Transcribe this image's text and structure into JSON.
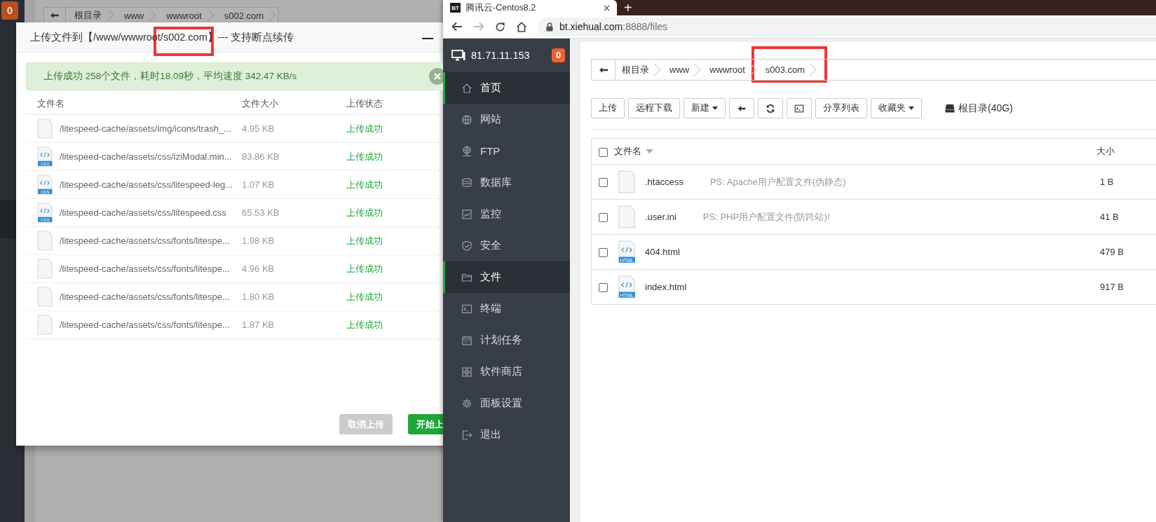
{
  "left_window": {
    "notice_badge": "0",
    "breadcrumb": [
      "根目录",
      "www",
      "wwwroot",
      "s002.com"
    ]
  },
  "upload_dialog": {
    "title": "上传文件到【/www/wwwroot/s002.com】--- 支持断点续传",
    "alert": "上传成功 258个文件，耗时18.09秒，平均速度 342.47 KB/s",
    "columns": [
      "文件名",
      "文件大小",
      "上传状态"
    ],
    "rows": [
      {
        "kind": "file",
        "name": "/litespeed-cache/assets/img/icons/trash_...",
        "size": "4.95 KB",
        "status": "上传成功"
      },
      {
        "kind": "css",
        "icon_label": "CSS",
        "name": "/litespeed-cache/assets/css/iziModal.min...",
        "size": "83.86 KB",
        "status": "上传成功"
      },
      {
        "kind": "css",
        "icon_label": "CSS",
        "name": "/litespeed-cache/assets/css/litespeed-leg...",
        "size": "1.07 KB",
        "status": "上传成功"
      },
      {
        "kind": "css",
        "icon_label": "CSS",
        "name": "/litespeed-cache/assets/css/litespeed.css",
        "size": "65.53 KB",
        "status": "上传成功"
      },
      {
        "kind": "file",
        "name": "/litespeed-cache/assets/css/fonts/litespe...",
        "size": "1.98 KB",
        "status": "上传成功"
      },
      {
        "kind": "file",
        "name": "/litespeed-cache/assets/css/fonts/litespe...",
        "size": "4.96 KB",
        "status": "上传成功"
      },
      {
        "kind": "file",
        "name": "/litespeed-cache/assets/css/fonts/litespe...",
        "size": "1.80 KB",
        "status": "上传成功"
      },
      {
        "kind": "file",
        "name": "/litespeed-cache/assets/css/fonts/litespe...",
        "size": "1.87 KB",
        "status": "上传成功"
      }
    ],
    "buttons": [
      {
        "label": "取消上传",
        "disabled": true
      },
      {
        "label": "开始上",
        "disabled": false
      }
    ]
  },
  "browser": {
    "tab_icon": "BT",
    "tab_title": "腾讯云-Centos8.2",
    "new_tab": "+",
    "url_host": "bt.xiehual.com",
    "url_path": ":8888/files"
  },
  "sidebar": {
    "server_ip": "81.71.11.153",
    "badge": "0",
    "items": [
      {
        "label": "首页",
        "selected": true
      },
      {
        "label": "网站",
        "selected": false
      },
      {
        "label": "FTP",
        "selected": false
      },
      {
        "label": "数据库",
        "selected": false
      },
      {
        "label": "监控",
        "selected": false
      },
      {
        "label": "安全",
        "selected": false
      },
      {
        "label": "文件",
        "selected": true
      },
      {
        "label": "终端",
        "selected": false
      },
      {
        "label": "计划任务",
        "selected": false
      },
      {
        "label": "软件商店",
        "selected": false
      },
      {
        "label": "面板设置",
        "selected": false
      },
      {
        "label": "退出",
        "selected": false
      }
    ]
  },
  "files": {
    "breadcrumb": [
      "根目录",
      "www",
      "wwwroot",
      "s003.com"
    ],
    "toolbar": [
      {
        "kind": "text",
        "label": "上传"
      },
      {
        "kind": "text",
        "label": "远程下载"
      },
      {
        "kind": "dropdown",
        "label": "新建"
      },
      {
        "kind": "back"
      },
      {
        "kind": "refresh"
      },
      {
        "kind": "console"
      },
      {
        "kind": "text",
        "label": "分享列表"
      },
      {
        "kind": "dropdown",
        "label": "收藏夹"
      }
    ],
    "disk": "根目录(40G)",
    "select_all": {
      "checked": false
    },
    "columns": [
      "文件名",
      "大小"
    ],
    "rows": [
      {
        "kind": "file",
        "name": ".htaccess",
        "note": "PS: Apache用户配置文件(伪静态)",
        "size": "1 B",
        "checked": false
      },
      {
        "kind": "file",
        "name": ".user.ini",
        "note": "PS: PHP用户配置文件(防跨站)!",
        "size": "41 B",
        "checked": false
      },
      {
        "kind": "html",
        "icon_label": "HTML",
        "name": "404.html",
        "size": "479 B",
        "checked": false
      },
      {
        "kind": "html",
        "icon_label": "HTML",
        "name": "index.html",
        "size": "917 B",
        "checked": false
      }
    ]
  }
}
